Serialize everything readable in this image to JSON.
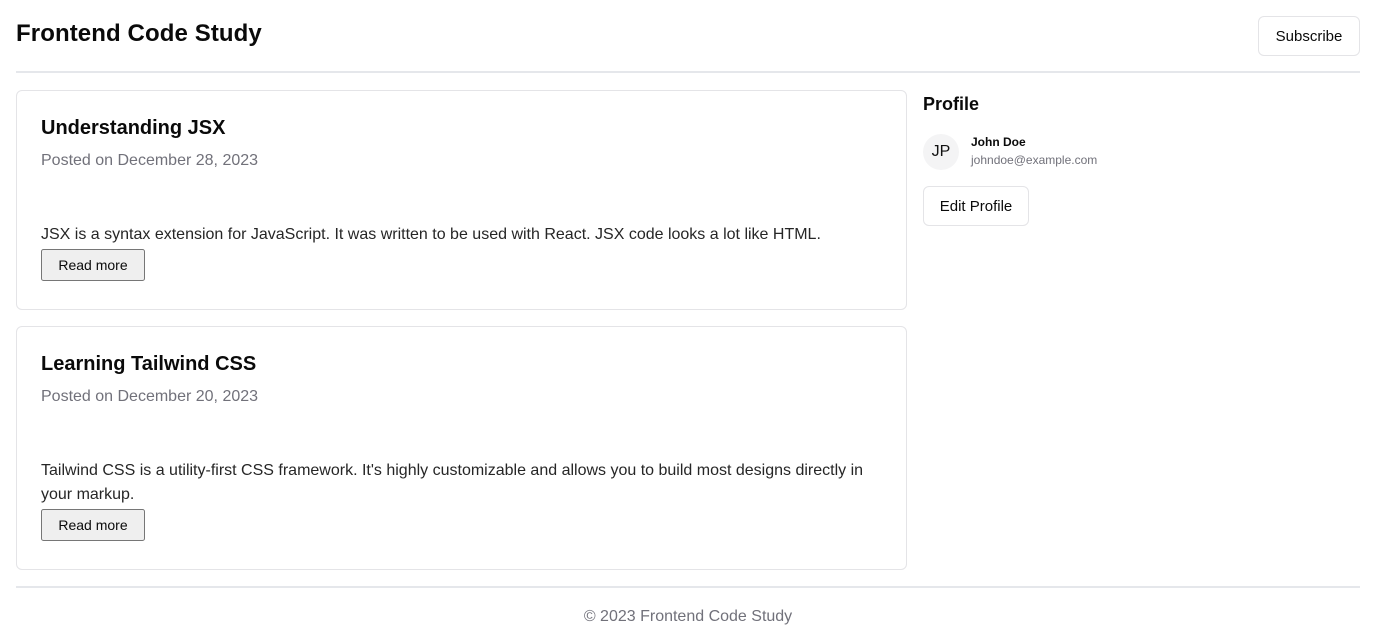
{
  "header": {
    "title": "Frontend Code Study",
    "subscribe_label": "Subscribe"
  },
  "posts": [
    {
      "title": "Understanding JSX",
      "date": "Posted on December 28, 2023",
      "body": "JSX is a syntax extension for JavaScript. It was written to be used with React. JSX code looks a lot like HTML.",
      "read_more_label": "Read more"
    },
    {
      "title": "Learning Tailwind CSS",
      "date": "Posted on December 20, 2023",
      "body": "Tailwind CSS is a utility-first CSS framework. It's highly customizable and allows you to build most designs directly in your markup.",
      "read_more_label": "Read more"
    }
  ],
  "profile": {
    "heading": "Profile",
    "avatar_initials": "JP",
    "name": "John Doe",
    "email": "johndoe@example.com",
    "edit_label": "Edit Profile"
  },
  "footer": {
    "text": "© 2023 Frontend Code Study"
  },
  "colors": {
    "text": "#0a0a0a",
    "muted": "#71717a",
    "border": "#e4e4e7",
    "avatar_bg": "#f4f4f5"
  }
}
